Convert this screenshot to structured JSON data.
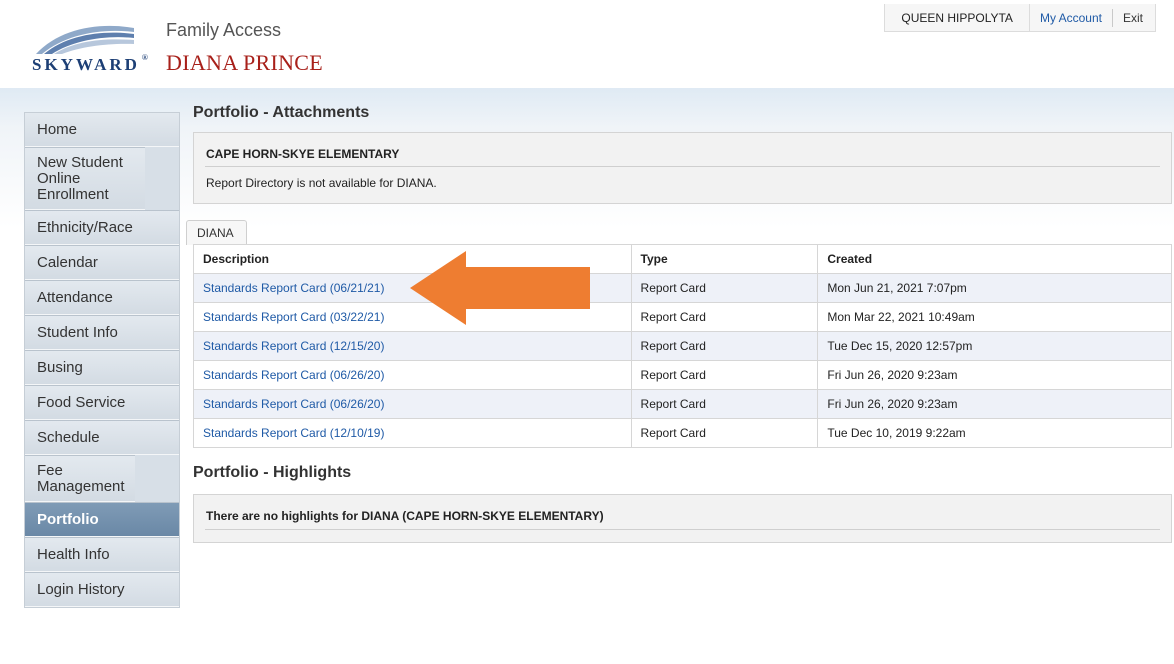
{
  "header": {
    "logo_text": "SKYWARD",
    "logo_mark": "®",
    "app_title": "Family Access",
    "student_name": "DIANA PRINCE"
  },
  "user_bar": {
    "user_name": "QUEEN HIPPOLYTA",
    "my_account_label": "My Account",
    "exit_label": "Exit"
  },
  "sidebar": {
    "items": [
      {
        "label": "Home"
      },
      {
        "label": "New Student Online Enrollment"
      },
      {
        "label": "Ethnicity/Race"
      },
      {
        "label": "Calendar"
      },
      {
        "label": "Attendance"
      },
      {
        "label": "Student Info"
      },
      {
        "label": "Busing"
      },
      {
        "label": "Food Service"
      },
      {
        "label": "Schedule"
      },
      {
        "label": "Fee Management"
      },
      {
        "label": "Portfolio"
      },
      {
        "label": "Health Info"
      },
      {
        "label": "Login History"
      }
    ],
    "active": "Portfolio"
  },
  "attachments": {
    "title": "Portfolio - Attachments",
    "school_name": "CAPE HORN-SKYE ELEMENTARY",
    "report_directory_message": "Report Directory is not available for DIANA.",
    "tab_label": "DIANA",
    "columns": {
      "description": "Description",
      "type": "Type",
      "created": "Created"
    },
    "rows": [
      {
        "description": "Standards Report Card (06/21/21)",
        "type": "Report Card",
        "created": "Mon Jun 21, 2021 7:07pm"
      },
      {
        "description": "Standards Report Card (03/22/21)",
        "type": "Report Card",
        "created": "Mon Mar 22, 2021 10:49am"
      },
      {
        "description": "Standards Report Card (12/15/20)",
        "type": "Report Card",
        "created": "Tue Dec 15, 2020 12:57pm"
      },
      {
        "description": "Standards Report Card (06/26/20)",
        "type": "Report Card",
        "created": "Fri Jun 26, 2020 9:23am"
      },
      {
        "description": "Standards Report Card (06/26/20)",
        "type": "Report Card",
        "created": "Fri Jun 26, 2020 9:23am"
      },
      {
        "description": "Standards Report Card (12/10/19)",
        "type": "Report Card",
        "created": "Tue Dec 10, 2019 9:22am"
      }
    ]
  },
  "highlights": {
    "title": "Portfolio - Highlights",
    "message": "There are no highlights for DIANA (CAPE HORN-SKYE ELEMENTARY)"
  },
  "colors": {
    "accent_link": "#1f5aa6",
    "student_name": "#a8201a",
    "arrow": "#ee7d31",
    "active_nav": "#6a88a6"
  },
  "icons": {
    "arrow": "arrow-left-icon",
    "logo": "skyward-swoosh-icon"
  }
}
